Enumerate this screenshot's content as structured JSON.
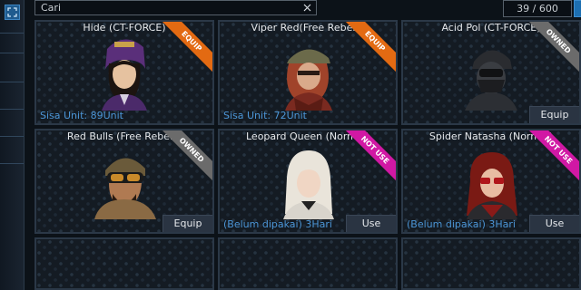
{
  "search": {
    "placeholder": "Cari"
  },
  "pagination": {
    "text": "39 / 600"
  },
  "colors": {
    "equip_ribbon": "#e36a12",
    "owned_ribbon": "#6b6b6b",
    "notuse_ribbon": "#d118a4",
    "info_text": "#4b95d6"
  },
  "cards": [
    {
      "name": "Hide (CT-FORCE)",
      "badge": "EQUIP",
      "info": "Sisa Unit: 89Unit",
      "action": ""
    },
    {
      "name": "Viper Red(Free Rebels)",
      "badge": "EQUIP",
      "info": "Sisa Unit: 72Unit",
      "action": ""
    },
    {
      "name": "Acid Pol (CT-FORCE)",
      "badge": "OWNED",
      "info": "",
      "action": "Equip"
    },
    {
      "name": "Red Bulls (Free Rebels)",
      "badge": "OWNED",
      "info": "",
      "action": "Equip"
    },
    {
      "name": "Leopard Queen (Normal)",
      "badge": "NOT USE",
      "info": "(Belum dipakai) 3Hari",
      "action": "Use"
    },
    {
      "name": "Spider Natasha (Normal)",
      "badge": "NOT USE",
      "info": "(Belum dipakai) 3Hari",
      "action": "Use"
    }
  ]
}
